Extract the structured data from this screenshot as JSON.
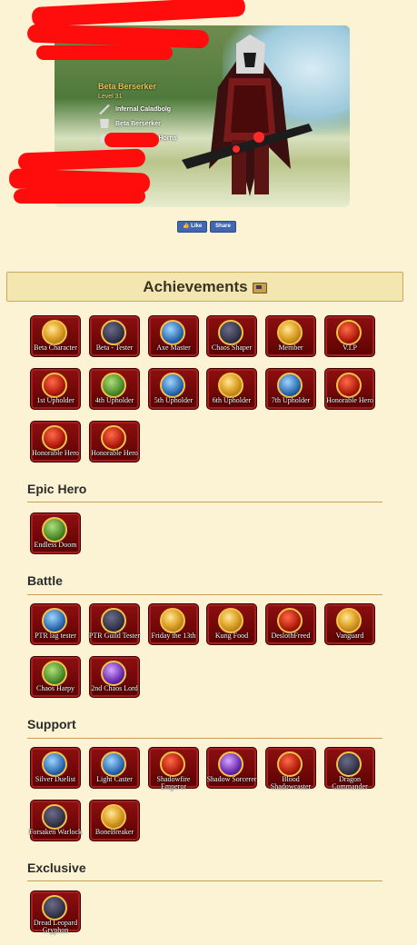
{
  "character": {
    "name": "Beta Berserker",
    "level": "Level 31",
    "equipment": [
      {
        "icon": "sword-icon",
        "label": "Infernal Caladbolg"
      },
      {
        "icon": "armor-icon",
        "label": "Beta Berserker"
      },
      {
        "icon": "helm-icon",
        "label": "Demonhunter Horns"
      }
    ]
  },
  "social": {
    "like_label": "Like",
    "share_label": "Share"
  },
  "achievements_title": "Achievements",
  "sections": {
    "main": {
      "badges": [
        {
          "label": "Beta Character",
          "tone": "gold"
        },
        {
          "label": "Beta - Tester",
          "tone": "dark"
        },
        {
          "label": "Axe Master",
          "tone": "blue"
        },
        {
          "label": "Chaos Shaper",
          "tone": "dark"
        },
        {
          "label": "Member",
          "tone": "gold"
        },
        {
          "label": "V.I.P",
          "tone": "red"
        },
        {
          "label": "1st Upholder",
          "tone": "red"
        },
        {
          "label": "4th Upholder",
          "tone": "green"
        },
        {
          "label": "5th Upholder",
          "tone": "blue"
        },
        {
          "label": "6th Upholder",
          "tone": "gold"
        },
        {
          "label": "7th Upholder",
          "tone": "blue"
        },
        {
          "label": "Honorable Hero",
          "tone": "red"
        },
        {
          "label": "Honorable Hero",
          "tone": "red"
        },
        {
          "label": "Honorable Hero",
          "tone": "red"
        }
      ]
    },
    "epic_hero": {
      "title": "Epic Hero",
      "badges": [
        {
          "label": "Endless Doom",
          "tone": "green"
        }
      ]
    },
    "battle": {
      "title": "Battle",
      "badges": [
        {
          "label": "PTR lag tester",
          "tone": "blue"
        },
        {
          "label": "PTR Guild Tester",
          "tone": "dark"
        },
        {
          "label": "Friday the 13th",
          "tone": "gold"
        },
        {
          "label": "Kung Food",
          "tone": "gold"
        },
        {
          "label": "DeslothFreed",
          "tone": "red"
        },
        {
          "label": "Vanguard",
          "tone": "gold"
        },
        {
          "label": "Chaos Harpy",
          "tone": "green"
        },
        {
          "label": "2nd Chaos Lord",
          "tone": "purple"
        }
      ]
    },
    "support": {
      "title": "Support",
      "badges": [
        {
          "label": "Silver Duelist",
          "tone": "blue"
        },
        {
          "label": "Light Caster",
          "tone": "blue"
        },
        {
          "label": "Shadowfire Emperor",
          "tone": "red"
        },
        {
          "label": "Shadow Sorcerer",
          "tone": "purple"
        },
        {
          "label": "Blood Shadowcaster",
          "tone": "red"
        },
        {
          "label": "Dragon Commander",
          "tone": "dark"
        },
        {
          "label": "Forsaken Warlock",
          "tone": "dark"
        },
        {
          "label": "BoneBreaker",
          "tone": "gold"
        }
      ]
    },
    "exclusive": {
      "title": "Exclusive",
      "badges": [
        {
          "label": "Dread Leopard Gryphon",
          "tone": "dark"
        }
      ]
    }
  }
}
